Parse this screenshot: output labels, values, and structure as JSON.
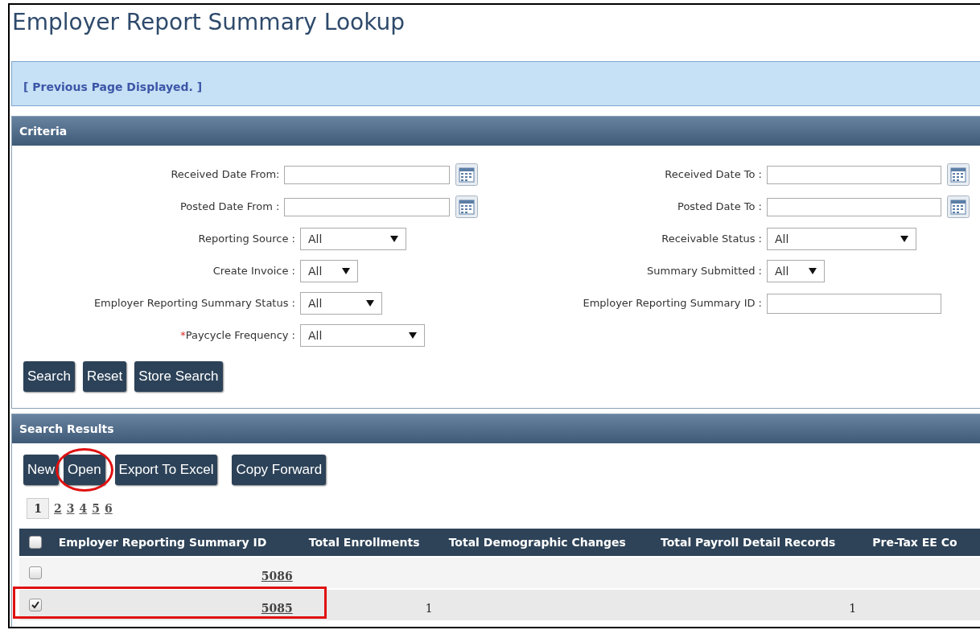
{
  "page_title": "Employer Report Summary Lookup",
  "message": "[ Previous Page Displayed. ]",
  "criteria": {
    "title": "Criteria",
    "rows": [
      {
        "left": {
          "kind": "date",
          "label": "Received Date From:"
        },
        "right": {
          "kind": "date",
          "label": "Received Date To :"
        }
      },
      {
        "left": {
          "kind": "date",
          "label": "Posted Date From :"
        },
        "right": {
          "kind": "date",
          "label": "Posted Date To :"
        }
      },
      {
        "left": {
          "kind": "select",
          "label": "Reporting Source :",
          "value": "All"
        },
        "right": {
          "kind": "select",
          "label": "Receivable Status :",
          "value": "All"
        }
      },
      {
        "left": {
          "kind": "select",
          "label": "Create Invoice :",
          "value": "All"
        },
        "right": {
          "kind": "select",
          "label": "Summary Submitted :",
          "value": "All"
        }
      },
      {
        "left": {
          "kind": "select",
          "label": "Employer Reporting Summary Status :",
          "value": "All"
        },
        "right": {
          "kind": "text",
          "label": "Employer Reporting Summary ID :"
        }
      },
      {
        "left": {
          "kind": "select",
          "label": "Paycycle Frequency :",
          "required_mark": "*",
          "value": "All"
        }
      }
    ],
    "buttons": [
      "Search",
      "Reset",
      "Store Search"
    ]
  },
  "results": {
    "title": "Search Results",
    "buttons": [
      {
        "label": "New",
        "circled": false
      },
      {
        "label": "Open",
        "circled": true
      },
      {
        "label": "Export To Excel",
        "circled": false
      },
      {
        "label": "Copy Forward",
        "circled": false
      }
    ],
    "pages": [
      {
        "label": "1",
        "selected": true
      },
      {
        "label": "2",
        "selected": false
      },
      {
        "label": "3",
        "selected": false
      },
      {
        "label": "4",
        "selected": false
      },
      {
        "label": "5",
        "selected": false
      },
      {
        "label": "6",
        "selected": false
      }
    ],
    "table": {
      "select_all_checked": false,
      "columns": [
        "Employer Reporting Summary ID",
        "Total Enrollments",
        "Total Demographic Changes",
        "Total Payroll Detail Records",
        "Pre-Tax EE Co"
      ],
      "rows": [
        {
          "checked": false,
          "highlighted": false,
          "cells": [
            "5086",
            "",
            "",
            "",
            ""
          ]
        },
        {
          "checked": true,
          "highlighted": true,
          "cells": [
            "5085",
            "1",
            "",
            "1",
            ""
          ]
        }
      ]
    }
  }
}
